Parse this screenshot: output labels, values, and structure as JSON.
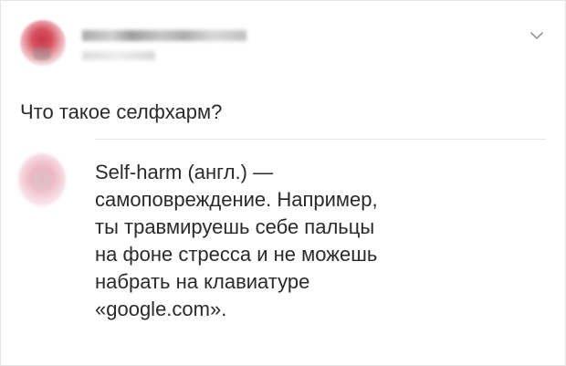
{
  "post": {
    "question": "Что такое селфхарм?"
  },
  "reply": {
    "lines": [
      "Self-harm (англ.) —",
      "самоповреждение. Например,",
      "ты травмируешь себе пальцы",
      "на фоне стресса и не можешь",
      "набрать на клавиатуре",
      "«google.com»."
    ]
  },
  "icons": {
    "menu": "chevron-down-icon"
  },
  "colors": {
    "text": "#2a2a2a",
    "divider": "#e6e6e6",
    "chevron": "#9a9a9a"
  }
}
